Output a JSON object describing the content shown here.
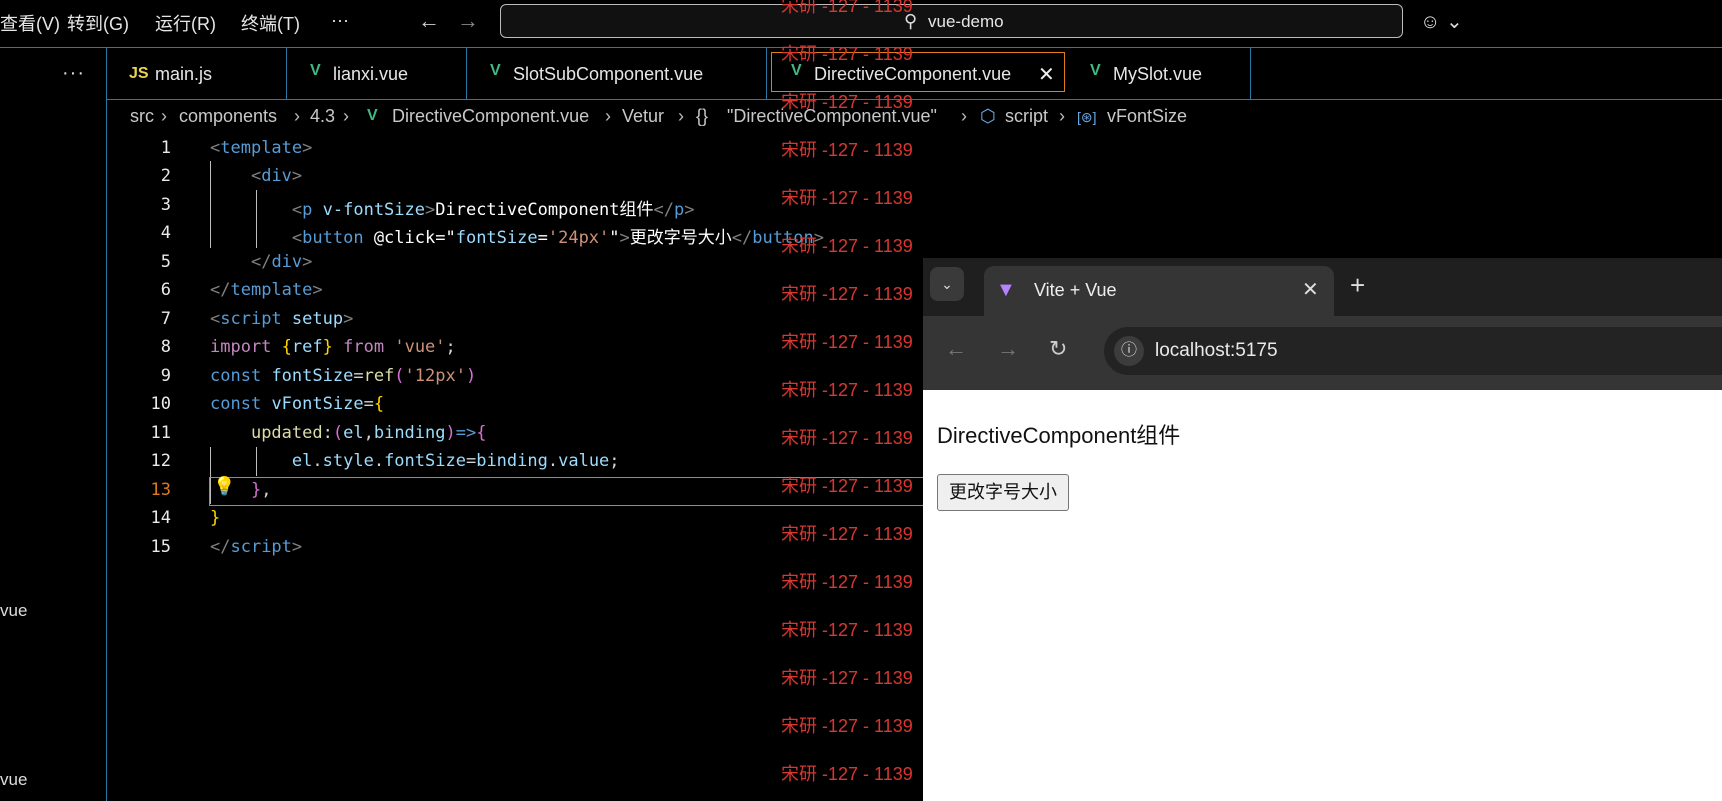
{
  "menu": {
    "view": "查看(V)",
    "goto": "转到(G)",
    "run": "运行(R)",
    "terminal": "终端(T)",
    "more": "···"
  },
  "search": {
    "text": "vue-demo"
  },
  "sidebar": {
    "more": "···",
    "item1": "vue",
    "item2": "vue"
  },
  "tabs": [
    {
      "icon": "JS",
      "label": "main.js"
    },
    {
      "icon": "V",
      "label": "lianxi.vue"
    },
    {
      "icon": "V",
      "label": "SlotSubComponent.vue"
    },
    {
      "icon": "V",
      "label": "DirectiveComponent.vue",
      "close": "✕"
    },
    {
      "icon": "V",
      "label": "MySlot.vue"
    }
  ],
  "breadcrumb": {
    "src": "src",
    "components": "components",
    "folder": "4.3",
    "file": "DirectiveComponent.vue",
    "vetur": "Vetur",
    "braces": "{}",
    "quoted": "\"DirectiveComponent.vue\"",
    "script": "script",
    "symbol": "vFontSize"
  },
  "editor": {
    "line_numbers": [
      "1",
      "2",
      "3",
      "4",
      "5",
      "6",
      "7",
      "8",
      "9",
      "10",
      "11",
      "12",
      "13",
      "14",
      "15"
    ],
    "current_line": 13
  },
  "watermark": {
    "text": "宋研 -127 - 1139"
  },
  "browser": {
    "tab_title": "Vite + Vue",
    "url": "localhost:5175",
    "page_text": "DirectiveComponent组件",
    "button_label": "更改字号大小"
  }
}
